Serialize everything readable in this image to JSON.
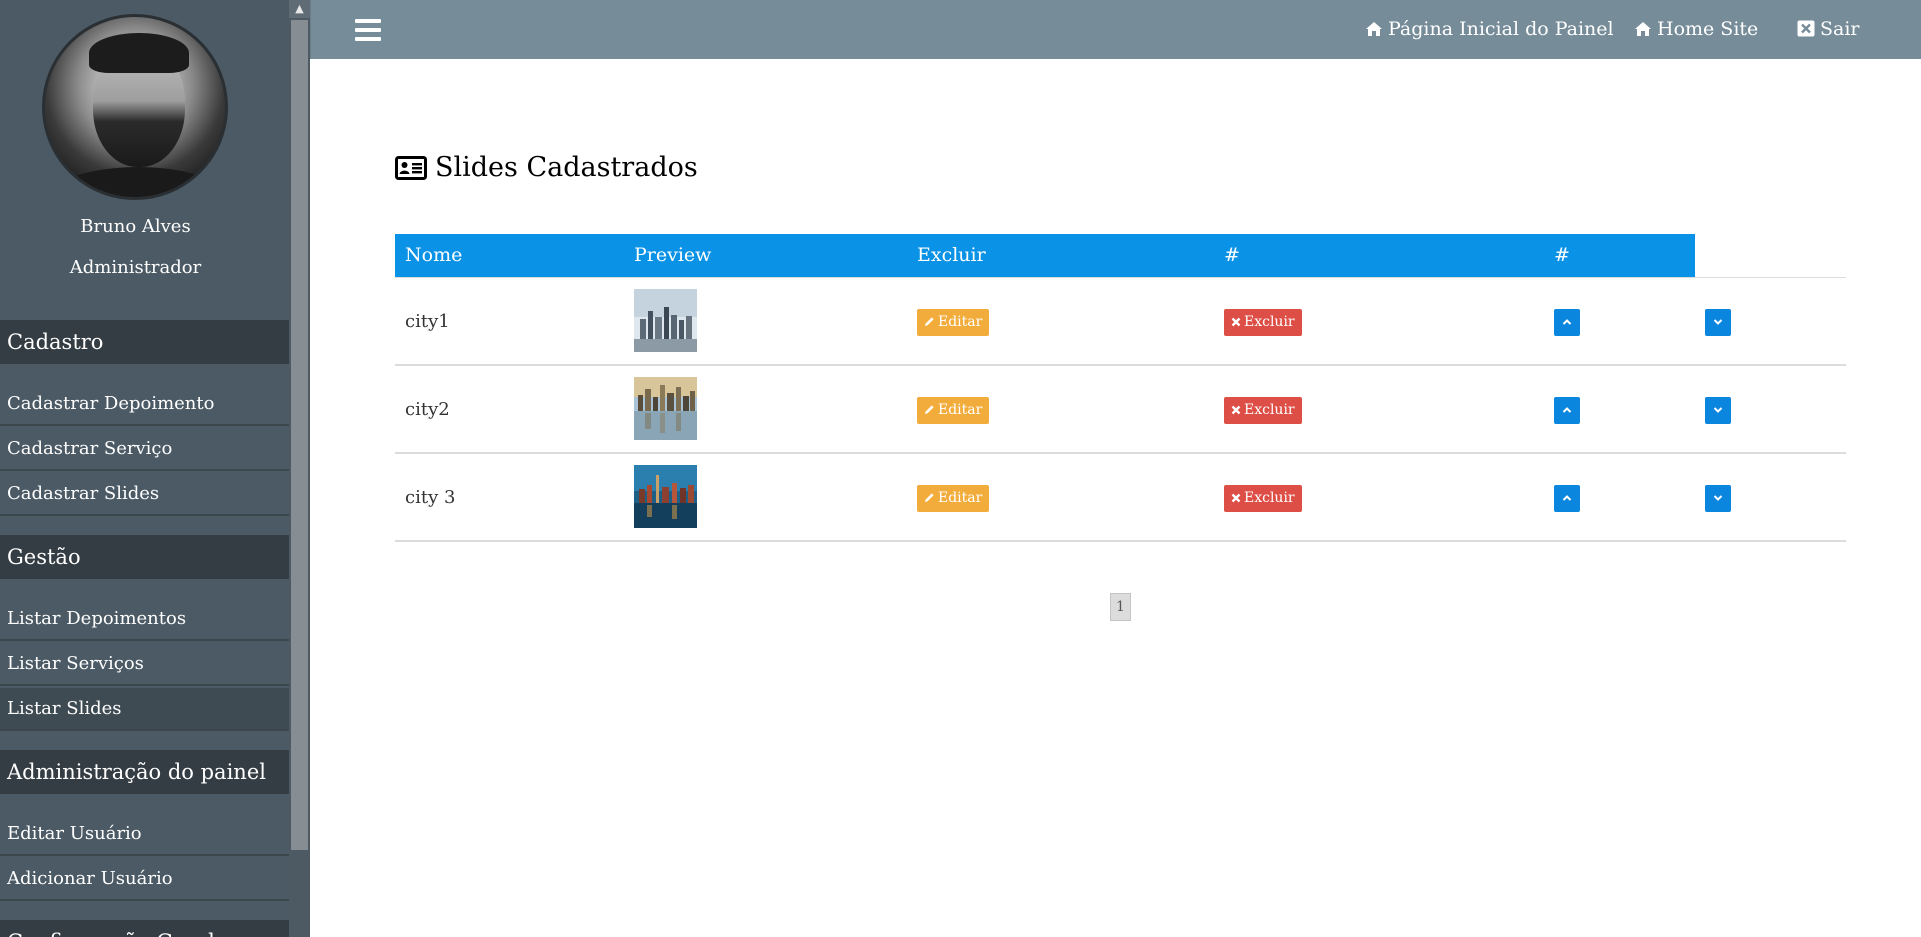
{
  "user": {
    "name": "Bruno Alves",
    "role": "Administrador"
  },
  "sidebar": {
    "sections": [
      {
        "title": "Cadastro",
        "items": [
          "Cadastrar Depoimento",
          "Cadastrar Serviço",
          "Cadastrar Slides"
        ]
      },
      {
        "title": "Gestão",
        "items": [
          "Listar Depoimentos",
          "Listar Serviços",
          "Listar Slides"
        ]
      },
      {
        "title": "Administração do painel",
        "items": [
          "Editar Usuário",
          "Adicionar Usuário"
        ]
      },
      {
        "title": "Configuração Geral",
        "items": []
      }
    ]
  },
  "topbar": {
    "menu_icon": "bars-icon",
    "links": [
      {
        "label": "Página Inicial do Painel",
        "icon": "home-icon"
      },
      {
        "label": "Home Site",
        "icon": "home-icon"
      },
      {
        "label": "Sair",
        "icon": "close-square-icon"
      }
    ]
  },
  "page": {
    "title": "Slides Cadastrados",
    "title_icon": "id-card-icon"
  },
  "table": {
    "headers": [
      "Nome",
      "Preview",
      "Excluir",
      "#",
      "#"
    ],
    "rows": [
      {
        "name": "city1",
        "edit_label": "Editar",
        "delete_label": "Excluir",
        "thumb": "city skyline white sky"
      },
      {
        "name": "city2",
        "edit_label": "Editar",
        "delete_label": "Excluir",
        "thumb": "city skyline reflection at sunset"
      },
      {
        "name": "city 3",
        "edit_label": "Editar",
        "delete_label": "Excluir",
        "thumb": "city harbor at dusk"
      }
    ]
  },
  "pagination": {
    "current": "1"
  },
  "colors": {
    "sidebar_bg": "#4b5a64",
    "sidebar_section_bg": "#343d43",
    "topbar_bg": "#778c99",
    "table_header_bg": "#0a92e6",
    "edit_button": "#f2ac3c",
    "delete_button": "#dc4e46",
    "arrow_button": "#0a86de"
  }
}
